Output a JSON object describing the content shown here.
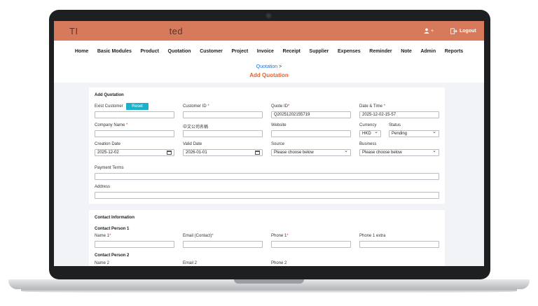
{
  "app": {
    "brand_left": "TI",
    "brand_right": "ted",
    "user_label": "+",
    "logout_label": "Logout"
  },
  "nav": [
    "Home",
    "Basic Modules",
    "Product",
    "Quotation",
    "Customer",
    "Project",
    "Invoice",
    "Receipt",
    "Supplier",
    "Expenses",
    "Reminder",
    "Note",
    "Admin",
    "Reports"
  ],
  "breadcrumb": {
    "link": "Quotation",
    "sep": ">"
  },
  "page_title": "Add Quotation",
  "form": {
    "section": "Add Quotation",
    "exist_customer": "Exist Customer",
    "reset": "Reset",
    "customer_id": "Customer ID",
    "quote_id": "Quote ID",
    "quote_id_value": "Q20251202155719",
    "date_time": "Date & Time",
    "date_time_value": "2025-12-02-15-57",
    "company_name": "Company Name",
    "company_name_cn": "中文公司名稱",
    "website": "Website",
    "currency": "Currency",
    "currency_value": "HKD",
    "status": "Status",
    "status_value": "Pending",
    "creation_date": "Creation Date",
    "creation_date_value": "2025-12-02",
    "valid_date": "Valid Date",
    "valid_date_value": "2026-01-01",
    "source": "Source",
    "source_value": "Please choose below",
    "business": "Business",
    "business_value": "Please choose below",
    "payment_terms": "Payment Terms",
    "address": "Address",
    "required_mark": "*"
  },
  "contact": {
    "section": "Contact Information",
    "person1": "Contact Person 1",
    "name1": "Name 1",
    "email_contact": "Email (Contact)",
    "phone1": "Phone 1",
    "phone1_extra": "Phone 1 extra",
    "person2": "Contact Person 2",
    "name2": "Name 2",
    "email2": "Email 2",
    "phone2": "Phone 2"
  }
}
